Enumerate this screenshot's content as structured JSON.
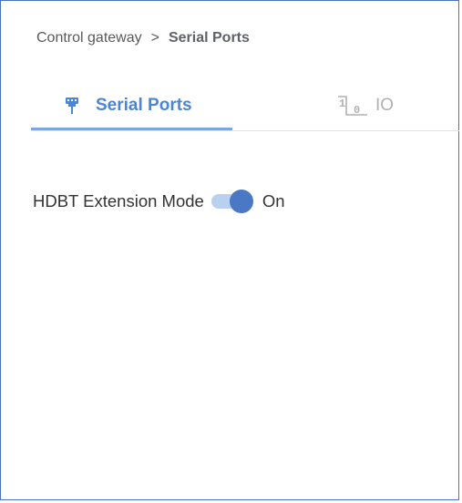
{
  "breadcrumb": {
    "parent": "Control gateway",
    "separator": ">",
    "current": "Serial Ports"
  },
  "tabs": [
    {
      "label": "Serial Ports",
      "icon": "serial-port-icon",
      "active": true
    },
    {
      "label": "IO",
      "icon": "io-icon",
      "active": false
    }
  ],
  "settings": {
    "hdbt_label": "HDBT Extension Mode",
    "hdbt_state": "On",
    "hdbt_enabled": true
  },
  "colors": {
    "accent": "#4a86d8",
    "frame": "#4a74b8",
    "toggle_knob": "#4a78c4",
    "toggle_track": "#b9d0f0",
    "inactive_tab": "#b0b0b0"
  }
}
